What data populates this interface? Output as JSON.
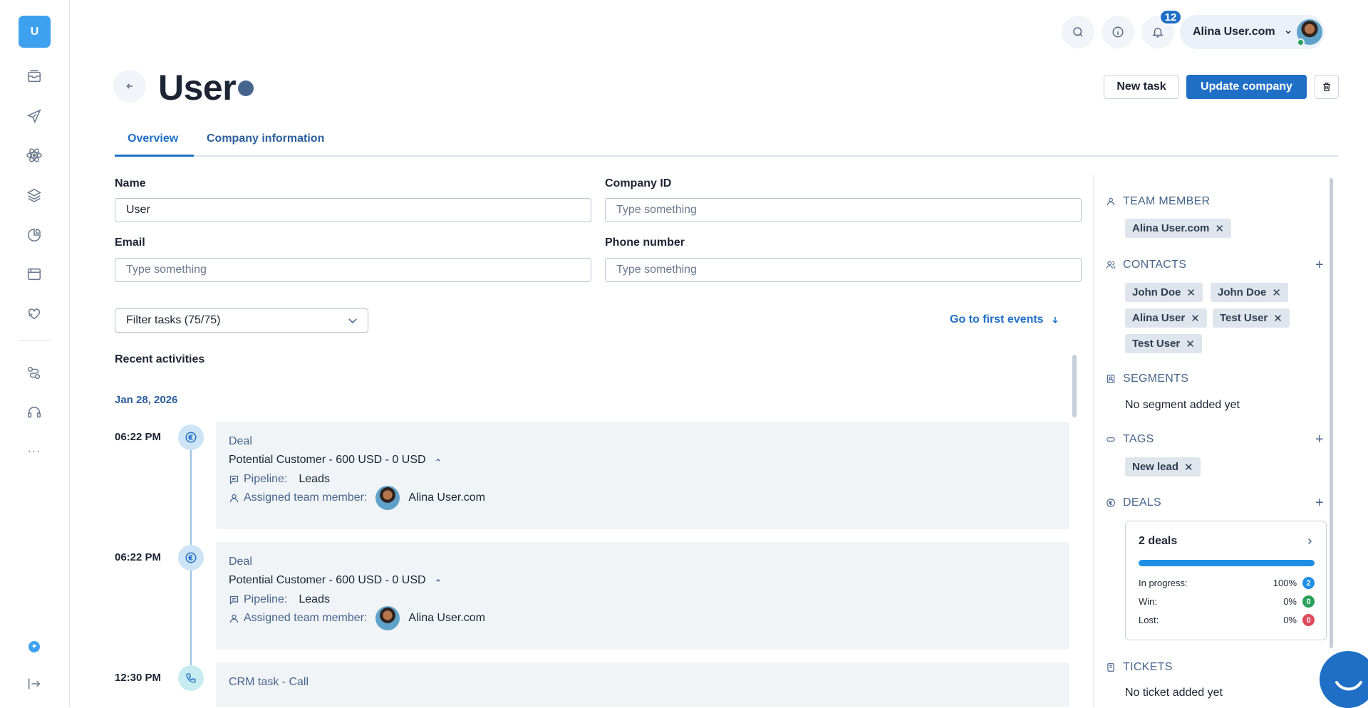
{
  "sidebar": {
    "logo_letter": "U",
    "items": [
      "inbox-icon",
      "send-icon",
      "atom-icon",
      "layers-icon",
      "pie-chart-icon",
      "browser-icon",
      "heart-hand-icon",
      "route-icon",
      "headset-icon",
      "more-icon"
    ],
    "bottom": [
      "sparkle-icon",
      "logout-icon"
    ]
  },
  "topbar": {
    "notification_count": "12",
    "user_name": "Alina User.com"
  },
  "page": {
    "title": "User",
    "new_task_label": "New task",
    "update_label": "Update company"
  },
  "tabs": [
    {
      "label": "Overview",
      "active": true
    },
    {
      "label": "Company information",
      "active": false
    }
  ],
  "form": {
    "name_label": "Name",
    "name_value": "User",
    "company_id_label": "Company ID",
    "company_id_placeholder": "Type something",
    "email_label": "Email",
    "email_placeholder": "Type something",
    "phone_label": "Phone number",
    "phone_placeholder": "Type something"
  },
  "activities": {
    "filter_label": "Filter tasks (75/75)",
    "go_first_label": "Go to first events",
    "section_title": "Recent activities",
    "date": "Jan 28, 2026",
    "items": [
      {
        "time": "06:22 PM",
        "type": "Deal",
        "title": "Potential Customer - 600 USD - 0 USD",
        "pipeline_label": "Pipeline:",
        "pipeline_value": "Leads",
        "assigned_label": "Assigned team member:",
        "assigned_value": "Alina User.com"
      },
      {
        "time": "06:22 PM",
        "type": "Deal",
        "title": "Potential Customer - 600 USD - 0 USD",
        "pipeline_label": "Pipeline:",
        "pipeline_value": "Leads",
        "assigned_label": "Assigned team member:",
        "assigned_value": "Alina User.com"
      },
      {
        "time": "12:30 PM",
        "type": "CRM task - Call"
      }
    ]
  },
  "right_panel": {
    "team_member_heading": "TEAM MEMBER",
    "team_member_chip": "Alina User.com",
    "contacts_heading": "CONTACTS",
    "contacts": [
      "John Doe",
      "John Doe",
      "Alina User",
      "Test User",
      "Test User"
    ],
    "segments_heading": "SEGMENTS",
    "segments_empty": "No segment added yet",
    "tags_heading": "TAGS",
    "tags": [
      "New lead"
    ],
    "deals_heading": "DEALS",
    "deals_summary": "2 deals",
    "deals_progress_pct": 100,
    "deals_rows": [
      {
        "label": "In progress:",
        "pct": "100%",
        "count": "2",
        "color": "#1f8fe6"
      },
      {
        "label": "Win:",
        "pct": "0%",
        "count": "0",
        "color": "#2aa05a"
      },
      {
        "label": "Lost:",
        "pct": "0%",
        "count": "0",
        "color": "#e04a5a"
      }
    ],
    "tickets_heading": "TICKETS",
    "tickets_empty": "No ticket added yet"
  },
  "colors": {
    "primary": "#1f6fc6",
    "accent": "#3ea1f0",
    "muted": "#46658d"
  }
}
